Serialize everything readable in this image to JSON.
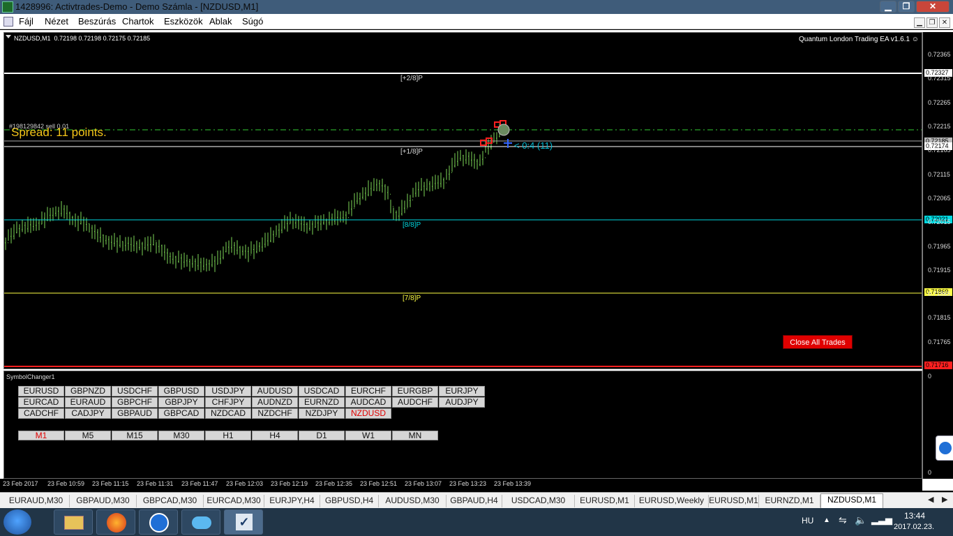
{
  "window": {
    "title": "1428996: Activtrades-Demo - Demo Számla - [NZDUSD,M1]",
    "minimize": "▁",
    "maximize": "❐",
    "close": "✕"
  },
  "menu": [
    "Fájl",
    "Nézet",
    "Beszúrás",
    "Chartok",
    "Eszközök",
    "Ablak",
    "Súgó"
  ],
  "mdi": [
    "▁",
    "❐",
    "✕"
  ],
  "chart": {
    "symbol_info": "NZDUSD,M1  0.72198 0.72198 0.72175 0.72185",
    "ea_label": "Quantum London Trading EA  v1.6.1",
    "order_label": "#198129842 sell 0.01",
    "spread": "Spread: 11 points.",
    "trade_note": "< 0:4 (11)",
    "close_button": "Close All Trades",
    "level_labels": [
      "[+2/8]P",
      "[+1/8]P",
      "[8/8]P",
      "[7/8]P"
    ],
    "colors": {
      "plus2": "#ffffff",
      "plus1": "#ffffff",
      "eight": "#00d8e0",
      "seven": "#ffff44",
      "bottom": "#ff2020",
      "order": "#33cc33",
      "candles": "#7ed957"
    },
    "price_ticks": [
      "0.72365",
      "0.72327",
      "0.72315",
      "0.72265",
      "0.72215",
      "0.72185",
      "0.72174",
      "0.72165",
      "0.72115",
      "0.72065",
      "0.72021",
      "0.72015",
      "0.71965",
      "0.71915",
      "0.71869",
      "0.71865",
      "0.71815",
      "0.71765",
      "0.71716"
    ],
    "price_highlight": {
      "plus2": "0.72327",
      "current": "0.72185",
      "plus1": "0.72174",
      "eight": "0.72021",
      "seven": "0.71869",
      "bottom": "0.71716"
    },
    "time_ticks": [
      "23 Feb 2017",
      "23 Feb 10:59",
      "23 Feb 11:15",
      "23 Feb 11:31",
      "23 Feb 11:47",
      "23 Feb 12:03",
      "23 Feb 12:19",
      "23 Feb 12:35",
      "23 Feb 12:51",
      "23 Feb 13:07",
      "23 Feb 13:23",
      "23 Feb 13:39"
    ]
  },
  "indicator": {
    "name": "SymbolChanger1",
    "scale_top": "0",
    "scale_bottom": "0",
    "symbols": [
      [
        "EURUSD",
        "GBPNZD",
        "USDCHF",
        "GBPUSD",
        "USDJPY",
        "AUDUSD",
        "USDCAD",
        "EURCHF",
        "EURGBP",
        "EURJPY"
      ],
      [
        "EURCAD",
        "EURAUD",
        "GBPCHF",
        "GBPJPY",
        "CHFJPY",
        "AUDNZD",
        "EURNZD",
        "AUDCAD",
        "AUDCHF",
        "AUDJPY"
      ],
      [
        "CADCHF",
        "CADJPY",
        "GBPAUD",
        "GBPCAD",
        "NZDCAD",
        "NZDCHF",
        "NZDJPY",
        "NZDUSD"
      ]
    ],
    "active_symbol": "NZDUSD",
    "timeframes": [
      "M1",
      "M5",
      "M15",
      "M30",
      "H1",
      "H4",
      "D1",
      "W1",
      "MN"
    ],
    "active_timeframe": "M1"
  },
  "tabs": [
    "EURAUD,M30",
    "GBPAUD,M30",
    "GBPCAD,M30",
    "EURCAD,M30",
    "EURJPY,H4",
    "GBPUSD,H4",
    "AUDUSD,M30",
    "GBPAUD,H4",
    "USDCAD,M30",
    "EURUSD,M1",
    "EURUSD,Weekly",
    "EURUSD,M1",
    "EURNZD,M1",
    "NZDUSD,M1"
  ],
  "active_tab": "NZDUSD,M1",
  "taskbar": {
    "lang": "HU",
    "time": "13:44",
    "date": "2017.02.23.",
    "apps": [
      "explorer-icon",
      "firefox-icon",
      "teamviewer-icon",
      "cloud-icon",
      "metatrader-icon"
    ]
  }
}
